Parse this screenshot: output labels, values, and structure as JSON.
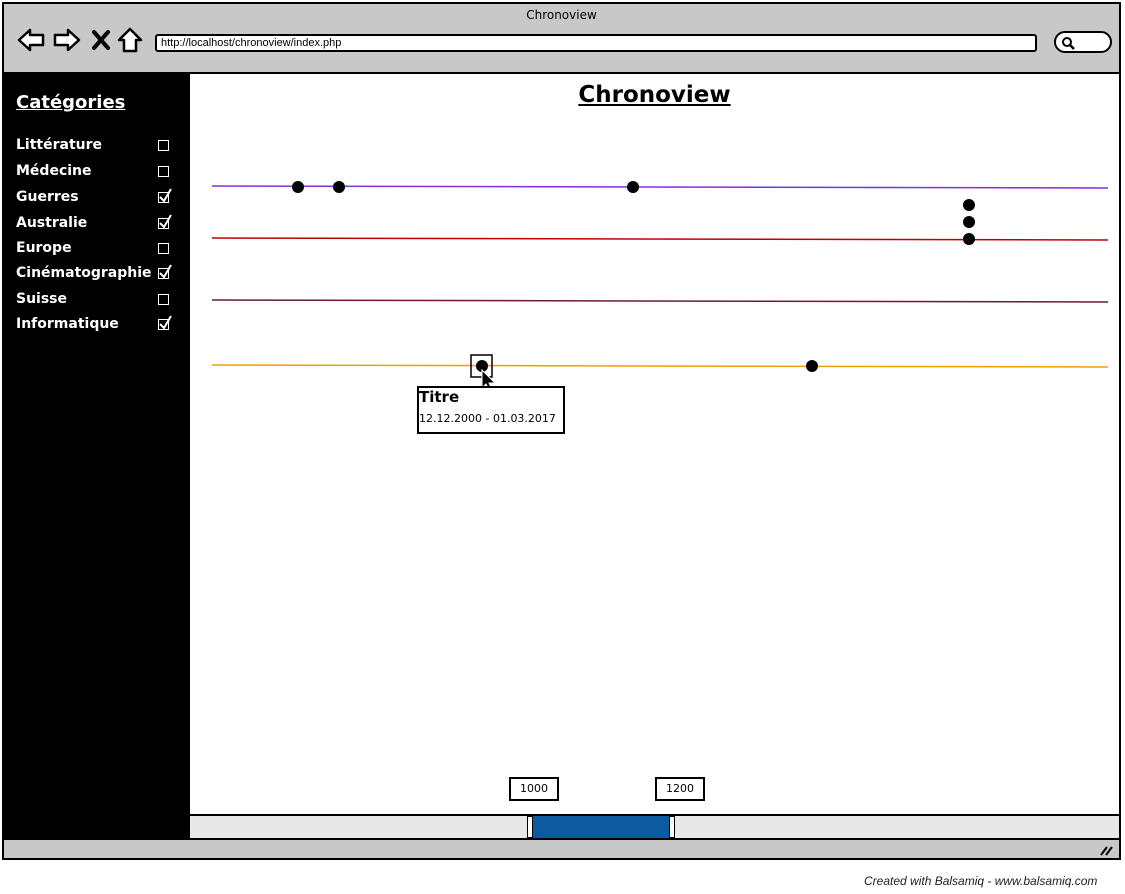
{
  "window": {
    "title": "Chronoview",
    "url": "http://localhost/chronoview/index.php"
  },
  "nav_icons": [
    "back-arrow-icon",
    "forward-arrow-icon",
    "close-icon",
    "home-icon",
    "search-icon"
  ],
  "sidebar": {
    "heading": "Catégories",
    "items": [
      {
        "label": "Littérature",
        "checked": false
      },
      {
        "label": "Médecine",
        "checked": false
      },
      {
        "label": "Guerres",
        "checked": true
      },
      {
        "label": "Australie",
        "checked": true
      },
      {
        "label": "Europe",
        "checked": false
      },
      {
        "label": "Cinématographie",
        "checked": true
      },
      {
        "label": "Suisse",
        "checked": false
      },
      {
        "label": "Informatique",
        "checked": true
      }
    ]
  },
  "main": {
    "title": "Chronoview",
    "timelines": [
      {
        "color": "#8a2be2"
      },
      {
        "color": "#c00000"
      },
      {
        "color": "#6a1a3a"
      },
      {
        "color": "#f0a000"
      }
    ],
    "tooltip": {
      "title": "Titre",
      "dates": "12.12.2000 - 01.03.2017"
    },
    "range": {
      "start": "1000",
      "end": "1200"
    }
  },
  "accent_color": "#0d5aa0",
  "credit": "Created with Balsamiq - www.balsamiq.com"
}
